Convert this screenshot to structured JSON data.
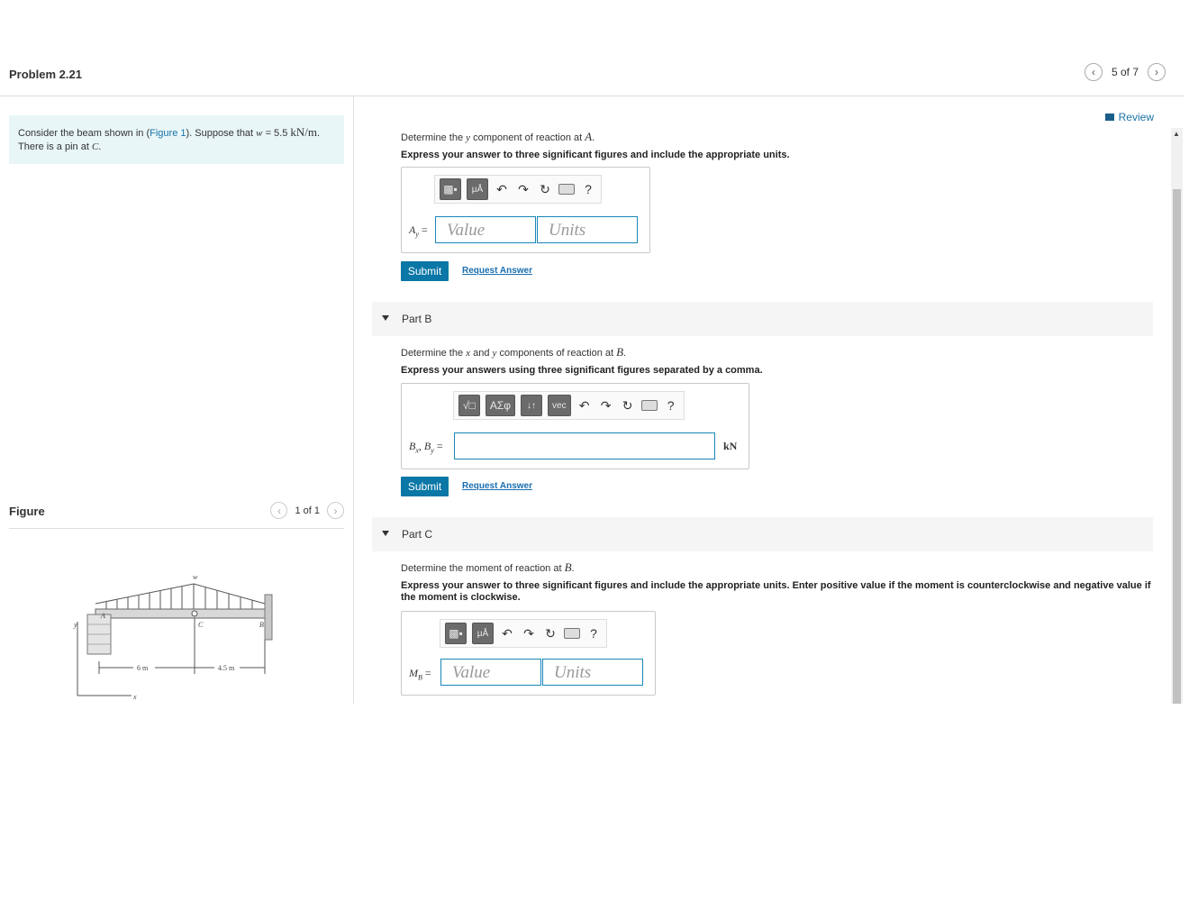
{
  "header": {
    "problem_title": "Problem 2.21",
    "pager_text": "5 of 7",
    "prev_icon": "chevron-left-icon",
    "next_icon": "chevron-right-icon"
  },
  "problem": {
    "text_before_link": "Consider the beam shown in (",
    "figure_link": "Figure 1",
    "text_after_link": "). Suppose that ",
    "w_symbol": "w",
    "w_value": " = 5.5 ",
    "w_unit": "kN/m",
    "text_end": ". There is a pin at ",
    "pin_point": "C",
    "period": "."
  },
  "figure": {
    "label": "Figure",
    "pager_text": "1 of 1",
    "labels": {
      "w": "w",
      "A": "A",
      "B": "B",
      "C": "C",
      "y": "y",
      "x": "x",
      "dim1": "6 m",
      "dim2": "4.5 m"
    }
  },
  "review": {
    "label": "Review"
  },
  "part_a": {
    "question_pre": "Determine the ",
    "question_var": "y",
    "question_mid": " component of reaction at ",
    "question_pt": "A",
    "question_end": ".",
    "instruction": "Express your answer to three significant figures and include the appropriate units.",
    "toolbar": {
      "mu": "μÅ",
      "help": "?"
    },
    "var_label": "Ay =",
    "var_main": "A",
    "var_sub": "y",
    "value_placeholder": "Value",
    "units_placeholder": "Units",
    "submit": "Submit",
    "request": "Request Answer"
  },
  "part_b": {
    "title": "Part B",
    "question_pre": "Determine the ",
    "question_var1": "x",
    "question_and": " and ",
    "question_var2": "y",
    "question_mid": " components of reaction at ",
    "question_pt": "B",
    "question_end": ".",
    "instruction": "Express your answers using three significant figures separated by a comma.",
    "toolbar": {
      "radical": "√□",
      "greek": "ΑΣφ",
      "arrows": "↓↑",
      "vec": "vec",
      "help": "?"
    },
    "var_bx": "B",
    "var_bx_sub": "x",
    "var_sep": ", ",
    "var_by": "B",
    "var_by_sub": "y",
    "var_eq": " =",
    "unit": "kN",
    "submit": "Submit",
    "request": "Request Answer"
  },
  "part_c": {
    "title": "Part C",
    "question_pre": "Determine the moment of reaction at ",
    "question_pt": "B",
    "question_end": ".",
    "instruction": "Express your answer to three significant figures and include the appropriate units. Enter positive value if the moment is counterclockwise and negative value if the moment is clockwise.",
    "toolbar": {
      "mu": "μÅ",
      "help": "?"
    },
    "var_main": "M",
    "var_sub": "B",
    "var_eq": " =",
    "value_placeholder": "Value",
    "units_placeholder": "Units"
  }
}
